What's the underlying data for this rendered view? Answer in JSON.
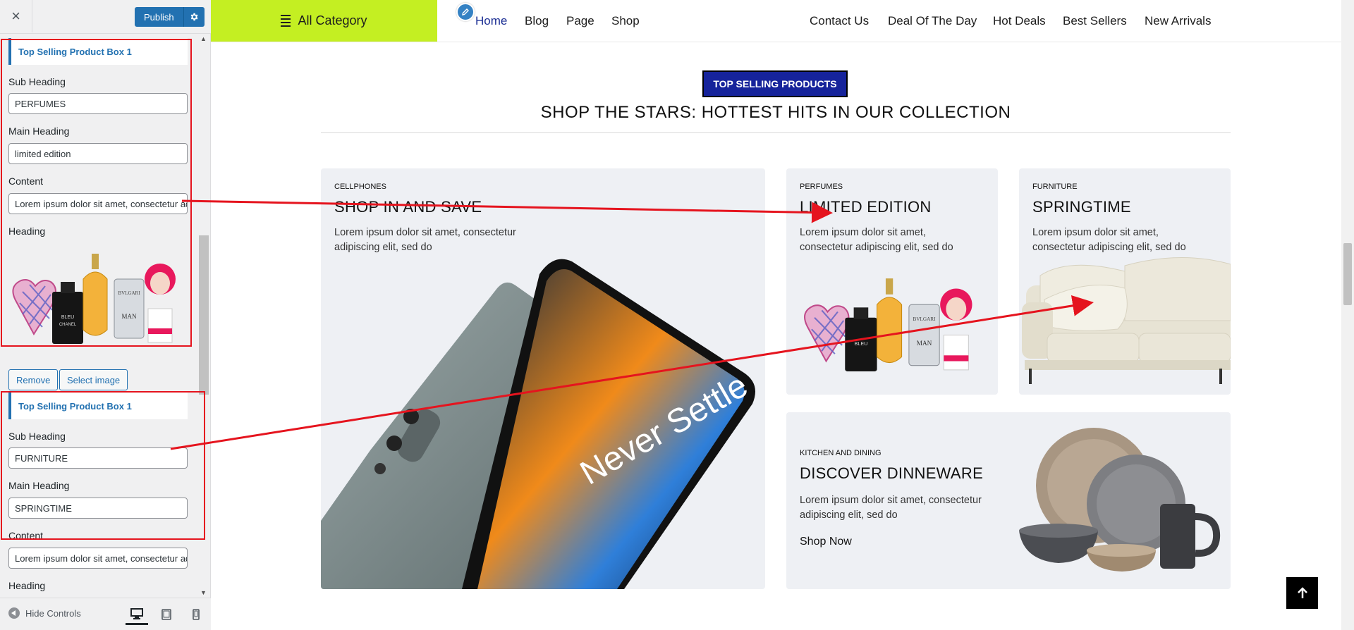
{
  "customizer": {
    "close_label": "×",
    "publish_label": "Publish",
    "box1": {
      "title": "Top Selling Product Box 1",
      "sub_heading_label": "Sub Heading",
      "sub_heading_value": "PERFUMES",
      "main_heading_label": "Main Heading",
      "main_heading_value": "limited edition",
      "content_label": "Content",
      "content_value": "Lorem ipsum dolor sit amet, consectetur adipiscing elit, sed do",
      "heading_label": "Heading",
      "image_name": "perfume-bottles",
      "remove_label": "Remove",
      "select_image_label": "Select image"
    },
    "box2": {
      "title": "Top Selling Product Box 1",
      "sub_heading_label": "Sub Heading",
      "sub_heading_value": "FURNITURE",
      "main_heading_label": "Main Heading",
      "main_heading_value": "SPRINGTIME",
      "content_label": "Content",
      "content_value": "Lorem ipsum dolor sit amet, consectetur adipiscing elit, sed do",
      "heading_label": "Heading"
    },
    "hide_controls_label": "Hide Controls",
    "devices": [
      "desktop",
      "tablet",
      "mobile"
    ],
    "active_device": "desktop"
  },
  "nav": {
    "all_category": "All Category",
    "left_items": [
      "Home",
      "Blog",
      "Page",
      "Shop"
    ],
    "active_item": "Home",
    "right_items": [
      "Contact Us",
      "Deal Of The Day",
      "Hot Deals",
      "Best Sellers",
      "New Arrivals"
    ]
  },
  "section": {
    "badge": "TOP SELLING PRODUCTS",
    "title": "SHOP THE STARS: HOTTEST HITS IN OUR COLLECTION"
  },
  "cards": {
    "cellphones": {
      "sub": "CELLPHONES",
      "main": "SHOP IN AND SAVE",
      "content_line1": "Lorem ipsum dolor sit amet, consectetur",
      "content_line2": "adipiscing elit, sed do",
      "image_text": "Never Settle"
    },
    "perfumes": {
      "sub": "PERFUMES",
      "main": "LIMITED EDITION",
      "content_line1": "Lorem ipsum dolor sit amet,",
      "content_line2": "consectetur adipiscing elit, sed do"
    },
    "furniture": {
      "sub": "FURNITURE",
      "main": "SPRINGTIME",
      "content_line1": "Lorem ipsum dolor sit amet,",
      "content_line2": "consectetur adipiscing elit, sed do"
    },
    "kitchen": {
      "sub": "KITCHEN AND DINING",
      "main": "DISCOVER DINNEWARE",
      "content_line1": "Lorem ipsum dolor sit amet, consectetur",
      "content_line2": "adipiscing elit, sed do",
      "shop_now": "Shop Now"
    }
  },
  "colors": {
    "accent_green": "#c4ef22",
    "badge_navy": "#16239b",
    "wp_blue": "#2271b1",
    "annotation_red": "#e5141e",
    "card_bg": "#eef0f4"
  }
}
